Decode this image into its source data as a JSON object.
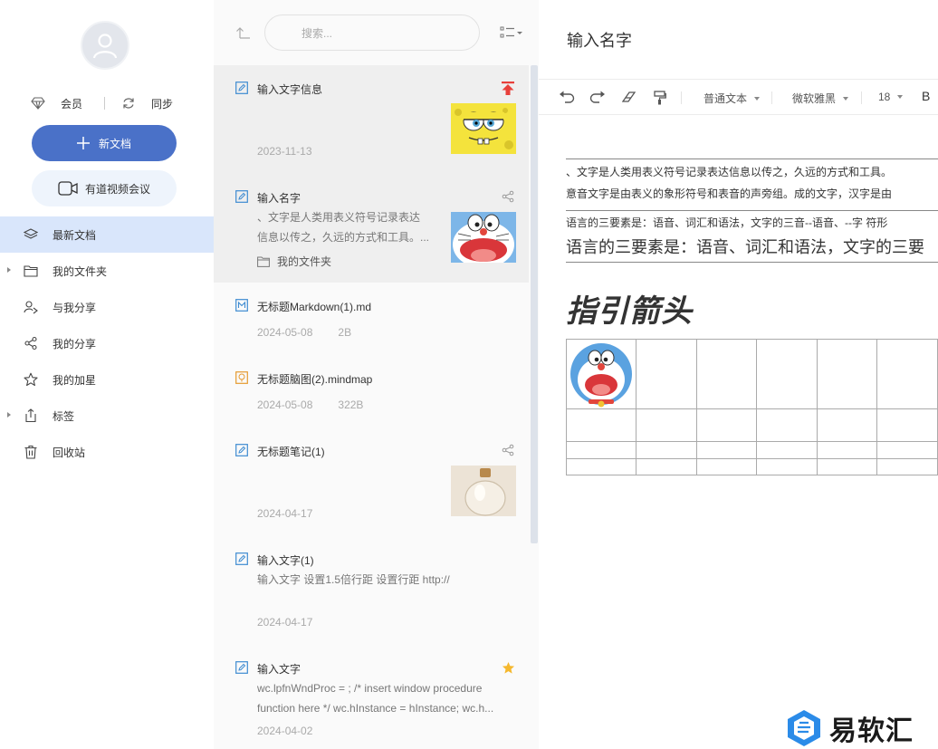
{
  "sidebar": {
    "vip_label": "会员",
    "sync_label": "同步",
    "new_doc_label": "新文档",
    "meeting_label": "有道视频会议",
    "nav": [
      {
        "label": "最新文档",
        "icon": "layers-icon"
      },
      {
        "label": "我的文件夹",
        "icon": "folder-icon"
      },
      {
        "label": "与我分享",
        "icon": "user-share-icon"
      },
      {
        "label": "我的分享",
        "icon": "share-icon"
      },
      {
        "label": "我的加星",
        "icon": "star-icon"
      },
      {
        "label": "标签",
        "icon": "tag-icon"
      },
      {
        "label": "回收站",
        "icon": "trash-icon"
      }
    ]
  },
  "list": {
    "search_placeholder": "搜索...",
    "notes": [
      {
        "title": "输入文字信息",
        "date": "2023-11-13",
        "flag": "pin-top-icon"
      },
      {
        "title": "输入名字",
        "snippet_1": "、文字是人类用表义符号记录表达",
        "snippet_2": "信息以传之，久远的方式和工具。...",
        "folder": "我的文件夹",
        "flag": "share-icon"
      },
      {
        "title": "无标题Markdown(1).md",
        "date": "2024-05-08",
        "size": "2B"
      },
      {
        "title": "无标题脑图(2).mindmap",
        "date": "2024-05-08",
        "size": "322B"
      },
      {
        "title": "无标题笔记(1)",
        "date": "2024-04-17",
        "flag": "share-icon"
      },
      {
        "title": "输入文字(1)",
        "snippet_1": "输入文字 设置1.5倍行距 设置行距 http://",
        "date": "2024-04-17"
      },
      {
        "title": "输入文字",
        "snippet_1": "wc.lpfnWndProc = ; /* insert window procedure",
        "snippet_2": "function here */ wc.hInstance = hInstance; wc.h...",
        "date": "2024-04-02",
        "flag": "star-icon"
      }
    ]
  },
  "editor": {
    "title": "输入名字",
    "toolbar": {
      "style": "普通文本",
      "font": "微软雅黑",
      "size": "18",
      "bold": "B"
    },
    "line1": "、文字是人类用表义符号记录表达信息以传之，久远的方式和工具。",
    "line2": "意音文字是由表义的象形符号和表音的声旁组。成的文字，汉字是由",
    "line3": "语言的三要素是：语音、词汇和语法，文字的三音--语音、--字 符形",
    "line4": "语言的三要素是：语音、词汇和语法，文字的三要",
    "heading": "指引箭头"
  },
  "watermark": "易软汇",
  "colors": {
    "accent": "#4a71c8",
    "nav_active": "#d9e6fb",
    "pin": "#e8403b",
    "star": "#f5b82e"
  }
}
